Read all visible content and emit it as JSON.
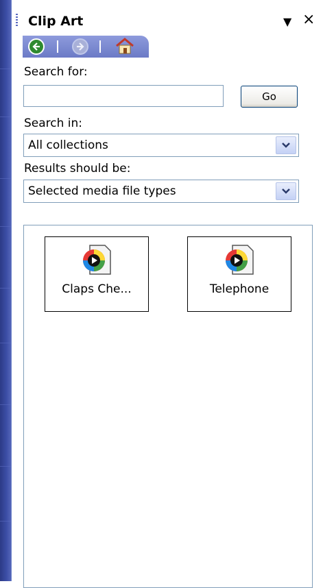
{
  "pane": {
    "title": "Clip Art",
    "menu_icon": "dropdown-arrow-icon",
    "close_icon": "close-icon"
  },
  "nav": {
    "back_icon": "back-arrow-icon",
    "forward_icon": "forward-arrow-icon",
    "home_icon": "home-icon"
  },
  "search": {
    "label": "Search for:",
    "value": "",
    "placeholder": "",
    "go_label": "Go"
  },
  "search_in": {
    "label": "Search in:",
    "selected": "All collections"
  },
  "results_type": {
    "label": "Results should be:",
    "selected": "Selected media file types"
  },
  "results": {
    "items": [
      {
        "caption": "Claps Che...",
        "icon": "media-file-icon"
      },
      {
        "caption": "Telephone",
        "icon": "media-file-icon"
      }
    ]
  },
  "colors": {
    "pane_border": "#7f9db9",
    "nav_bar": "#7b89d0",
    "left_strip": "#3c4ea6"
  }
}
